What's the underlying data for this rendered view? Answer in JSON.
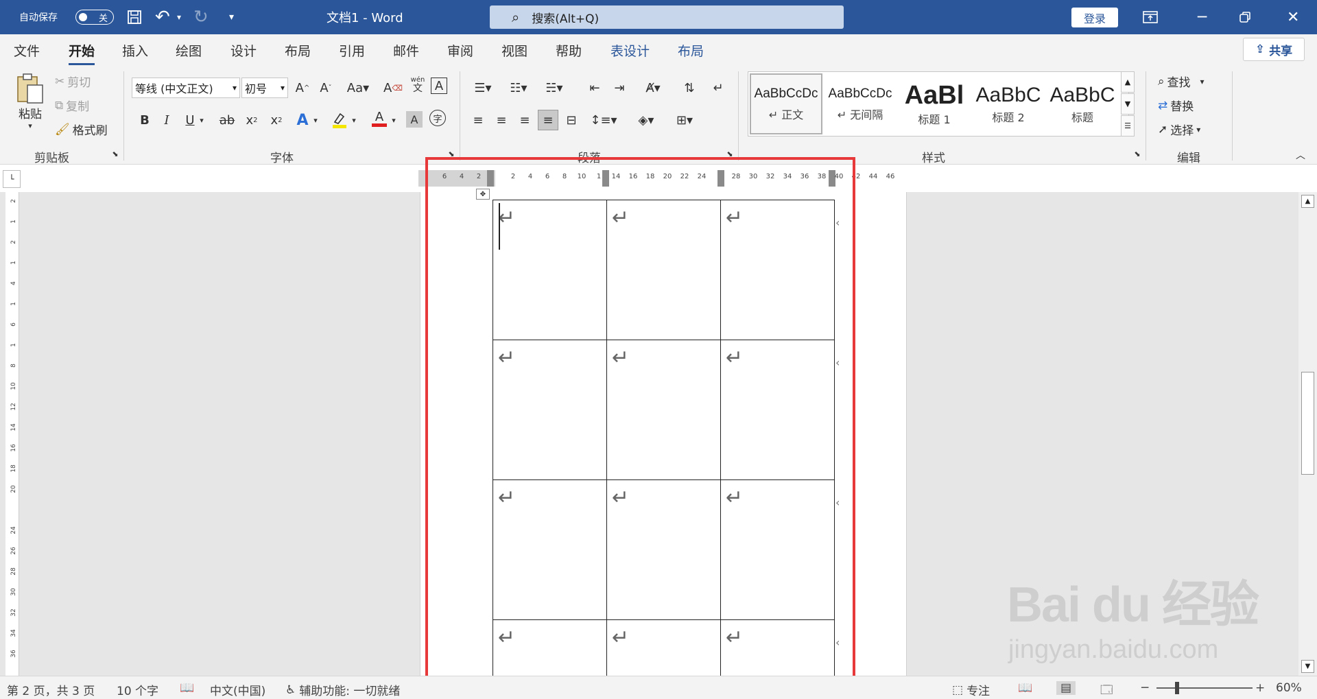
{
  "title_bar": {
    "autosave_label": "自动保存",
    "autosave_state": "关",
    "doc_title": "文档1  -  Word",
    "search_placeholder": "搜索(Alt+Q)",
    "login": "登录",
    "icons": [
      "save-icon",
      "undo-icon",
      "redo-icon",
      "customize-icon",
      "ribbon-display-icon",
      "restore-icon",
      "close-icon"
    ]
  },
  "tabs": [
    {
      "label": "文件",
      "active": false,
      "contextual": false
    },
    {
      "label": "开始",
      "active": true,
      "contextual": false
    },
    {
      "label": "插入",
      "active": false,
      "contextual": false
    },
    {
      "label": "绘图",
      "active": false,
      "contextual": false
    },
    {
      "label": "设计",
      "active": false,
      "contextual": false
    },
    {
      "label": "布局",
      "active": false,
      "contextual": false
    },
    {
      "label": "引用",
      "active": false,
      "contextual": false
    },
    {
      "label": "邮件",
      "active": false,
      "contextual": false
    },
    {
      "label": "审阅",
      "active": false,
      "contextual": false
    },
    {
      "label": "视图",
      "active": false,
      "contextual": false
    },
    {
      "label": "帮助",
      "active": false,
      "contextual": false
    },
    {
      "label": "表设计",
      "active": false,
      "contextual": true
    },
    {
      "label": "布局",
      "active": false,
      "contextual": true
    }
  ],
  "share_label": "共享",
  "ribbon": {
    "clipboard": {
      "paste": "粘贴",
      "cut": "剪切",
      "copy": "复制",
      "format_painter": "格式刷",
      "group": "剪贴板"
    },
    "font": {
      "font_name": "等线 (中文正文)",
      "font_size": "初号",
      "group": "字体",
      "font_color": "#e02020",
      "highlight_color": "#f5e600",
      "phonetic": "wén",
      "phonetic_base": "文",
      "enclose": "字"
    },
    "paragraph": {
      "group": "段落"
    },
    "styles": {
      "group": "样式",
      "items": [
        {
          "sample": "AaBbCcDc",
          "name": "↵ 正文"
        },
        {
          "sample": "AaBbCcDc",
          "name": "↵ 无间隔"
        },
        {
          "sample": "AaBl",
          "name": "标题 1"
        },
        {
          "sample": "AaBbC",
          "name": "标题 2"
        },
        {
          "sample": "AaBbC",
          "name": "标题"
        }
      ]
    },
    "editing": {
      "find": "查找",
      "replace": "替换",
      "select": "选择",
      "group": "编辑"
    }
  },
  "ruler": {
    "ticks": [
      "6",
      "4",
      "2",
      "",
      "2",
      "4",
      "6",
      "8",
      "10",
      "1",
      "14",
      "16",
      "18",
      "20",
      "22",
      "24",
      "",
      "28",
      "30",
      "32",
      "34",
      "36",
      "38",
      "40",
      "42",
      "44",
      "46"
    ],
    "vticks": [
      "2",
      "1",
      "2",
      "1",
      "4",
      "1",
      "6",
      "1",
      "8",
      "10",
      "12",
      "14",
      "16",
      "18",
      "20",
      "",
      "24",
      "26",
      "28",
      "30",
      "32",
      "34",
      "36"
    ]
  },
  "table": {
    "rows": 4,
    "cols": 3,
    "para_mark": "↵",
    "end_mark": "‹"
  },
  "status_bar": {
    "page": "第 2 页，共 3 页",
    "words": "10 个字",
    "language": "中文(中国)",
    "accessibility": "辅助功能: 一切就绪",
    "focus": "专注",
    "zoom": "60%",
    "zoom_level": 0.6
  },
  "watermark": {
    "logo": "Bai du 经验",
    "url": "jingyan.baidu.com"
  },
  "highlight_color": "#e8393a"
}
